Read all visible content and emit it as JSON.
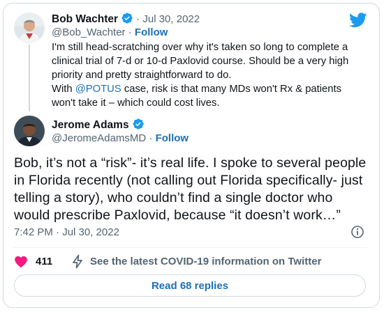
{
  "quoted": {
    "name": "Bob Wachter",
    "date": "Jul 30, 2022",
    "handle": "@Bob_Wachter",
    "follow": "Follow",
    "text_lines": [
      "I'm still head-scratching over why it's taken so long to complete a",
      "clinical trial of 7-d or 10-d Paxlovid course. Should be a very high",
      "priority and pretty straightforward to do."
    ],
    "line4_prefix": "With ",
    "line4_mention": "@POTUS",
    "line4_suffix": " case, risk is that many MDs won't Rx & patients",
    "line5": "won't take it – which could cost lives."
  },
  "tweet": {
    "name": "Jerome Adams",
    "handle": "@JeromeAdamsMD",
    "follow": "Follow",
    "text_lines": [
      "Bob, it’s not a “risk”- it’s real life. I spoke to several people",
      "in Florida recently (not calling out Florida specifically- just",
      "telling a story), who couldn’t find a single doctor who",
      "would prescribe Paxlovid, because “it doesn’t work…”"
    ],
    "time": "7:42 PM · Jul 30, 2022"
  },
  "actions": {
    "likes": "411",
    "covid_info": "See the latest COVID-19 information on Twitter",
    "read_replies": "Read 68 replies"
  },
  "icons": {
    "twitter": "twitter-bird-icon",
    "verified": "verified-badge-icon",
    "info": "info-icon",
    "heart": "heart-icon",
    "bolt": "lightning-bolt-icon"
  },
  "colors": {
    "twitter_blue": "#1d9bf0",
    "link_blue": "#1d70b8",
    "heart_pink": "#f91880",
    "secondary_text": "#536471"
  }
}
